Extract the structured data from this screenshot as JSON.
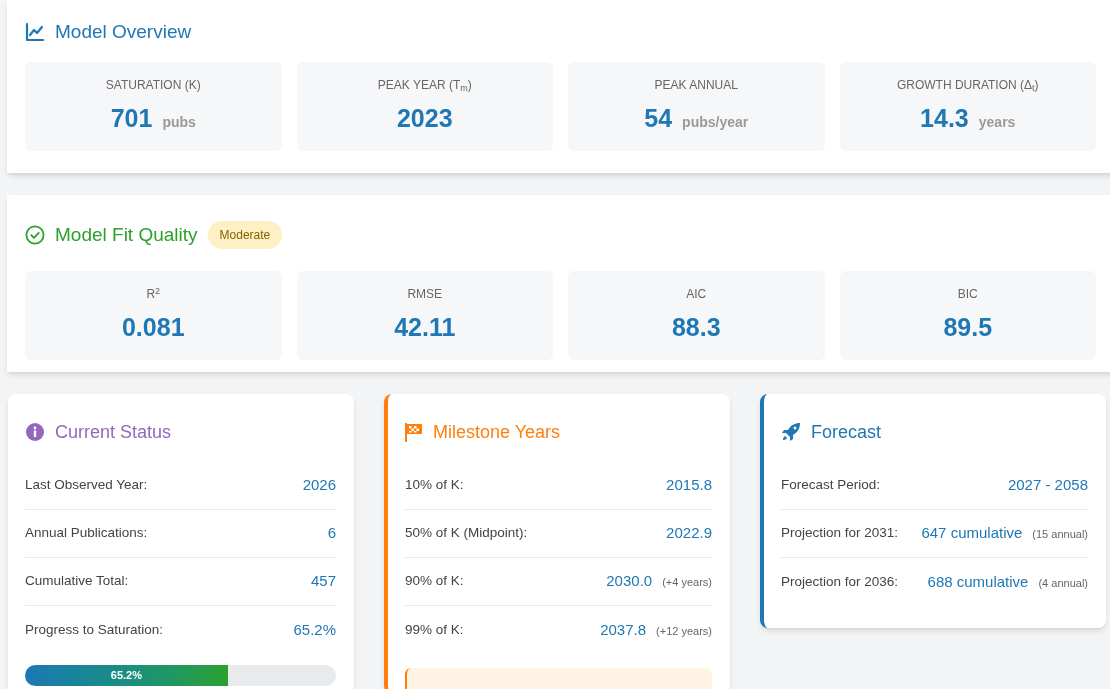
{
  "overview": {
    "title": "Model Overview",
    "stats": [
      {
        "label": "SATURATION (K)",
        "value": "701",
        "unit": "pubs"
      },
      {
        "label": "PEAK YEAR (T$_{m}$)",
        "value": "2023"
      },
      {
        "label": "PEAK ANNUAL",
        "value": "54",
        "unit": "pubs/year"
      },
      {
        "label": "GROWTH DURATION (Δ$_{t}$)",
        "value": "14.3",
        "unit": "years"
      }
    ]
  },
  "fit_quality": {
    "title": "Model Fit Quality",
    "badge": "Moderate",
    "stats": [
      {
        "label": "R$^{2}$",
        "value": "0.081"
      },
      {
        "label": "RMSE",
        "value": "42.11"
      },
      {
        "label": "AIC",
        "value": "88.3"
      },
      {
        "label": "BIC",
        "value": "89.5"
      }
    ]
  },
  "cards": [
    {
      "kind": "status",
      "title": "Current Status",
      "rows": [
        {
          "label": "Last Observed Year:",
          "value": "2026"
        },
        {
          "label": "Annual Publications:",
          "value": "6"
        },
        {
          "label": "Cumulative Total:",
          "value": "457"
        },
        {
          "label": "Progress to Saturation:",
          "value": "65.2%"
        }
      ],
      "progress": {
        "level": 0.652,
        "label": "65.2%"
      }
    },
    {
      "kind": "milestones",
      "title": "Milestone Years",
      "rows": [
        {
          "label": "10% of K:",
          "value": "2015.8"
        },
        {
          "label": "50% of K (Midpoint):",
          "value": "2022.9"
        },
        {
          "label": "90% of K:",
          "value": "2030.0",
          "note": "(+4 years)"
        },
        {
          "label": "99% of K:",
          "value": "2037.8",
          "note": "(+12 years)"
        }
      ]
    },
    {
      "kind": "forecast",
      "title": "Forecast",
      "rows": [
        {
          "label": "Forecast Period:",
          "value": "2027 - 2058"
        },
        {
          "label": "Projection for 2031:",
          "value": "647 cumulative",
          "note": "(15 annual)"
        },
        {
          "label": "Projection for 2036:",
          "value": "688 cumulative",
          "note": "(4 annual)"
        }
      ]
    }
  ]
}
